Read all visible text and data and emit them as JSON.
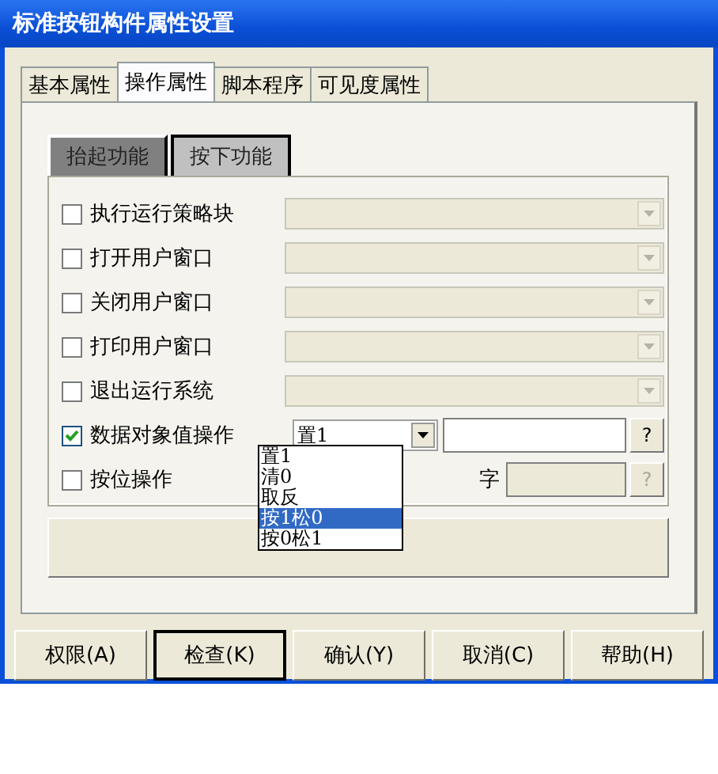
{
  "window": {
    "title": "标准按钮构件属性设置"
  },
  "tabs": [
    {
      "label": "基本属性",
      "selected": false
    },
    {
      "label": "操作属性",
      "selected": true
    },
    {
      "label": "脚本程序",
      "selected": false
    },
    {
      "label": "可见度属性",
      "selected": false
    }
  ],
  "subtabs": [
    {
      "label": "抬起功能",
      "selected": true
    },
    {
      "label": "按下功能",
      "selected": false
    }
  ],
  "actions": [
    {
      "kind": "combo",
      "label": "执行运行策略块",
      "checked": false,
      "disabled": true
    },
    {
      "kind": "combo",
      "label": "打开用户窗口",
      "checked": false,
      "disabled": true
    },
    {
      "kind": "combo",
      "label": "关闭用户窗口",
      "checked": false,
      "disabled": true
    },
    {
      "kind": "combo",
      "label": "打印用户窗口",
      "checked": false,
      "disabled": true
    },
    {
      "kind": "combo",
      "label": "退出运行系统",
      "checked": false,
      "disabled": true
    },
    {
      "kind": "value",
      "label": "数据对象值操作",
      "checked": true,
      "value": "置1",
      "help": "?",
      "disabled": false
    },
    {
      "kind": "bit",
      "label": "按位操作",
      "checked": false,
      "note": "字",
      "help": "?",
      "disabled": true
    }
  ],
  "dropdown": {
    "options": [
      {
        "label": "置1",
        "selected": false
      },
      {
        "label": "清0",
        "selected": false
      },
      {
        "label": "取反",
        "selected": false
      },
      {
        "label": "按1松0",
        "selected": true
      },
      {
        "label": "按0松1",
        "selected": false
      }
    ]
  },
  "buttons": [
    {
      "label": "权限(A)",
      "default": false
    },
    {
      "label": "检查(K)",
      "default": true
    },
    {
      "label": "确认(Y)",
      "default": false
    },
    {
      "label": "取消(C)",
      "default": false
    },
    {
      "label": "帮助(H)",
      "default": false
    }
  ]
}
